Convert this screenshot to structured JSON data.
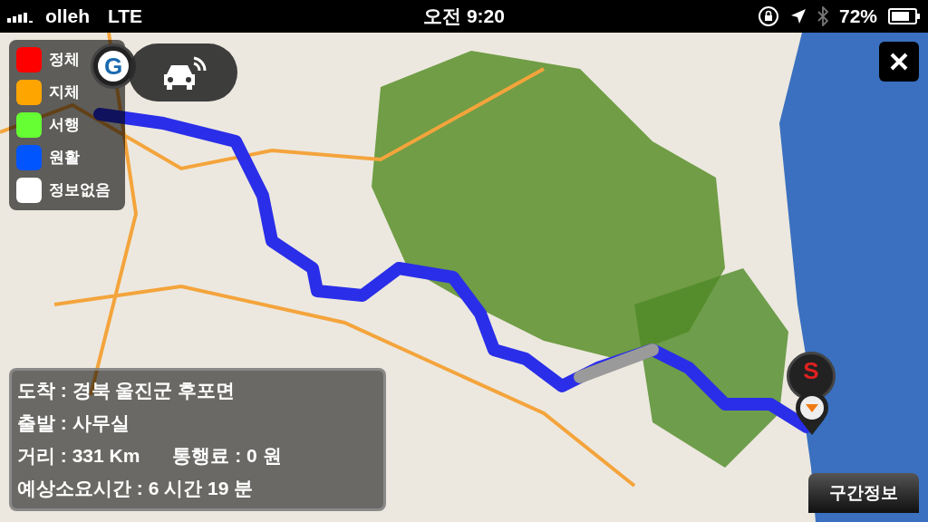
{
  "status_bar": {
    "carrier": "olleh",
    "network": "LTE",
    "time": "오전 9:20",
    "battery": "72%"
  },
  "legend": [
    {
      "label": "정체",
      "color": "#ff0000"
    },
    {
      "label": "지체",
      "color": "#ffa500"
    },
    {
      "label": "서행",
      "color": "#66ff33"
    },
    {
      "label": "원활",
      "color": "#0055ff"
    },
    {
      "label": "정보없음",
      "color": "#ffffff"
    }
  ],
  "markers": [
    {
      "kind": "goal",
      "label": "G"
    },
    {
      "kind": "start",
      "label": "S"
    }
  ],
  "route_info": {
    "lines": [
      [
        "도착 : 경북 울진군 후포면"
      ],
      [
        "출발 : 사무실"
      ],
      [
        "거리 : 331 Km",
        "통행료 : 0 원"
      ],
      [
        "예상소요시간 : 6 시간 19 분"
      ]
    ]
  },
  "section_info_button": "구간정보"
}
